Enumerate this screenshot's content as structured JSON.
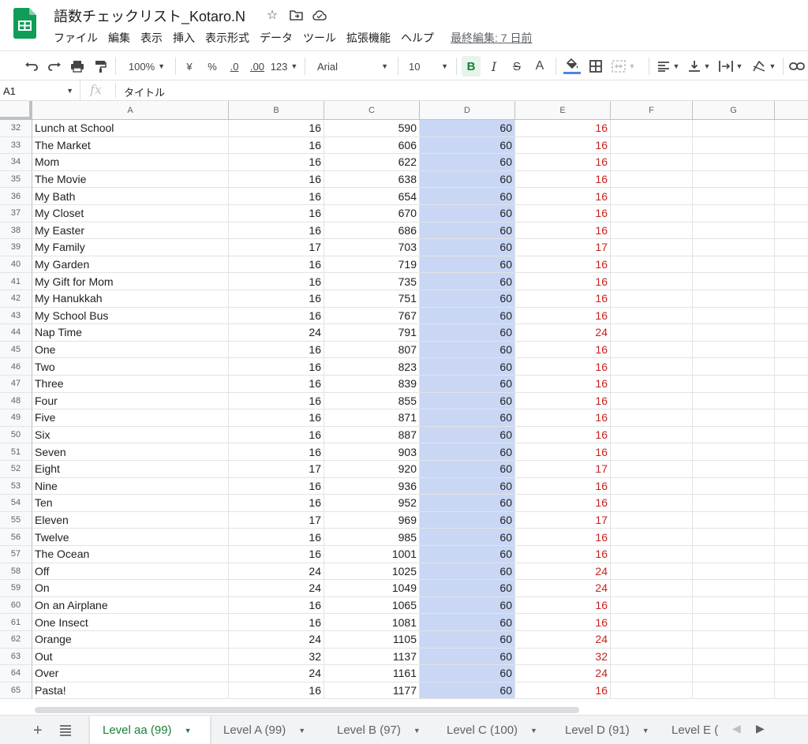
{
  "doc": {
    "title": "語数チェックリスト_Kotaro.N",
    "last_edit": "最終編集: 7 日前"
  },
  "menu": [
    "ファイル",
    "編集",
    "表示",
    "挿入",
    "表示形式",
    "データ",
    "ツール",
    "拡張機能",
    "ヘルプ"
  ],
  "toolbar": {
    "zoom": "100%",
    "currency": "¥",
    "percent": "%",
    "dec_decrease": ".0",
    "dec_increase": ".00",
    "number_format": "123",
    "font": "Arial",
    "font_size": "10",
    "bold": "B",
    "italic": "I",
    "strike": "S",
    "text_color": "A"
  },
  "formula_bar": {
    "cell_ref": "A1",
    "fx": "fx",
    "content": "タイトル"
  },
  "columns": [
    "A",
    "B",
    "C",
    "D",
    "E",
    "F",
    "G"
  ],
  "rows": [
    {
      "n": "32",
      "a": "Lunch at School",
      "b": "16",
      "c": "590",
      "d": "60",
      "e": "16"
    },
    {
      "n": "33",
      "a": "The Market",
      "b": "16",
      "c": "606",
      "d": "60",
      "e": "16"
    },
    {
      "n": "34",
      "a": "Mom",
      "b": "16",
      "c": "622",
      "d": "60",
      "e": "16"
    },
    {
      "n": "35",
      "a": "The Movie",
      "b": "16",
      "c": "638",
      "d": "60",
      "e": "16"
    },
    {
      "n": "36",
      "a": "My Bath",
      "b": "16",
      "c": "654",
      "d": "60",
      "e": "16"
    },
    {
      "n": "37",
      "a": "My Closet",
      "b": "16",
      "c": "670",
      "d": "60",
      "e": "16"
    },
    {
      "n": "38",
      "a": "My Easter",
      "b": "16",
      "c": "686",
      "d": "60",
      "e": "16"
    },
    {
      "n": "39",
      "a": "My Family",
      "b": "17",
      "c": "703",
      "d": "60",
      "e": "17"
    },
    {
      "n": "40",
      "a": "My Garden",
      "b": "16",
      "c": "719",
      "d": "60",
      "e": "16"
    },
    {
      "n": "41",
      "a": "My Gift for Mom",
      "b": "16",
      "c": "735",
      "d": "60",
      "e": "16"
    },
    {
      "n": "42",
      "a": "My Hanukkah",
      "b": "16",
      "c": "751",
      "d": "60",
      "e": "16"
    },
    {
      "n": "43",
      "a": "My School Bus",
      "b": "16",
      "c": "767",
      "d": "60",
      "e": "16"
    },
    {
      "n": "44",
      "a": "Nap Time",
      "b": "24",
      "c": "791",
      "d": "60",
      "e": "24"
    },
    {
      "n": "45",
      "a": "One",
      "b": "16",
      "c": "807",
      "d": "60",
      "e": "16"
    },
    {
      "n": "46",
      "a": "Two",
      "b": "16",
      "c": "823",
      "d": "60",
      "e": "16"
    },
    {
      "n": "47",
      "a": "Three",
      "b": "16",
      "c": "839",
      "d": "60",
      "e": "16"
    },
    {
      "n": "48",
      "a": "Four",
      "b": "16",
      "c": "855",
      "d": "60",
      "e": "16"
    },
    {
      "n": "49",
      "a": "Five",
      "b": "16",
      "c": "871",
      "d": "60",
      "e": "16"
    },
    {
      "n": "50",
      "a": "Six",
      "b": "16",
      "c": "887",
      "d": "60",
      "e": "16"
    },
    {
      "n": "51",
      "a": "Seven",
      "b": "16",
      "c": "903",
      "d": "60",
      "e": "16"
    },
    {
      "n": "52",
      "a": "Eight",
      "b": "17",
      "c": "920",
      "d": "60",
      "e": "17"
    },
    {
      "n": "53",
      "a": "Nine",
      "b": "16",
      "c": "936",
      "d": "60",
      "e": "16"
    },
    {
      "n": "54",
      "a": "Ten",
      "b": "16",
      "c": "952",
      "d": "60",
      "e": "16"
    },
    {
      "n": "55",
      "a": "Eleven",
      "b": "17",
      "c": "969",
      "d": "60",
      "e": "17"
    },
    {
      "n": "56",
      "a": "Twelve",
      "b": "16",
      "c": "985",
      "d": "60",
      "e": "16"
    },
    {
      "n": "57",
      "a": "The Ocean",
      "b": "16",
      "c": "1001",
      "d": "60",
      "e": "16"
    },
    {
      "n": "58",
      "a": "Off",
      "b": "24",
      "c": "1025",
      "d": "60",
      "e": "24"
    },
    {
      "n": "59",
      "a": "On",
      "b": "24",
      "c": "1049",
      "d": "60",
      "e": "24"
    },
    {
      "n": "60",
      "a": "On an Airplane",
      "b": "16",
      "c": "1065",
      "d": "60",
      "e": "16"
    },
    {
      "n": "61",
      "a": "One Insect",
      "b": "16",
      "c": "1081",
      "d": "60",
      "e": "16"
    },
    {
      "n": "62",
      "a": "Orange",
      "b": "24",
      "c": "1105",
      "d": "60",
      "e": "24"
    },
    {
      "n": "63",
      "a": "Out",
      "b": "32",
      "c": "1137",
      "d": "60",
      "e": "32"
    },
    {
      "n": "64",
      "a": "Over",
      "b": "24",
      "c": "1161",
      "d": "60",
      "e": "24"
    },
    {
      "n": "65",
      "a": "Pasta!",
      "b": "16",
      "c": "1177",
      "d": "60",
      "e": "16"
    }
  ],
  "sheets": [
    {
      "label": "Level aa (99)",
      "active": true
    },
    {
      "label": "Level A (99)",
      "active": false
    },
    {
      "label": "Level B (97)",
      "active": false
    },
    {
      "label": "Level C (100)",
      "active": false
    },
    {
      "label": "Level D (91)",
      "active": false
    },
    {
      "label": "Level E (",
      "active": false
    }
  ],
  "colors": {
    "accent_green": "#188038",
    "selected_column": "#c9d7f5",
    "red_text": "#c5221f"
  }
}
